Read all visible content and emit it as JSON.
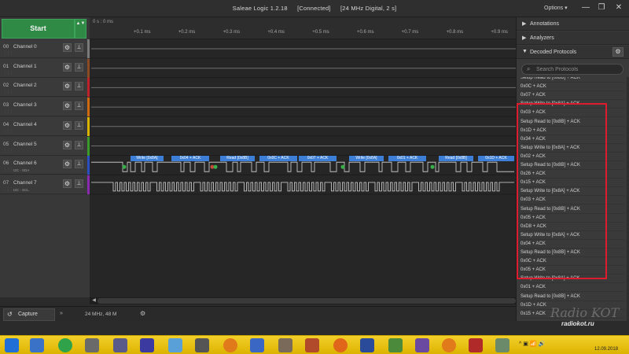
{
  "window": {
    "app": "Saleae Logic 1.2.18",
    "status": "[Connected]",
    "mode": "[24 MHz Digital, 2 s]",
    "options_label": "Options ▾",
    "minimize": "—",
    "restore": "❐",
    "close": "✕"
  },
  "controls": {
    "start_label": "Start",
    "start_arrows": "▲▼"
  },
  "channels": [
    {
      "num": "00",
      "name": "Channel 0",
      "sub": "",
      "color": "#7a7a7a"
    },
    {
      "num": "01",
      "name": "Channel 1",
      "sub": "",
      "color": "#8a4b22"
    },
    {
      "num": "02",
      "name": "Channel 2",
      "sub": "",
      "color": "#c0202a"
    },
    {
      "num": "03",
      "name": "Channel 3",
      "sub": "",
      "color": "#d06a10"
    },
    {
      "num": "04",
      "name": "Channel 4",
      "sub": "",
      "color": "#d8b400"
    },
    {
      "num": "05",
      "name": "Channel 5",
      "sub": "",
      "color": "#3a9a2a"
    },
    {
      "num": "06",
      "name": "Channel 6",
      "sub": "I2C - SDA",
      "color": "#2a4fc0"
    },
    {
      "num": "07",
      "name": "Channel 7",
      "sub": "I2C - SCL",
      "color": "#8a2ab0"
    }
  ],
  "timeline": {
    "origin": "0 s : 0 ms",
    "ticks": [
      "+0.1 ms",
      "+0.2 ms",
      "+0.3 ms",
      "+0.4 ms",
      "+0.5 ms",
      "+0.6 ms",
      "+0.7 ms",
      "+0.8 ms",
      "+0.9 ms"
    ]
  },
  "decoded_labels": [
    "Write [0x8A]",
    "0x04 + ACK",
    "Read [0x8B]",
    "0x0C + ACK",
    "0x07 + ACK",
    "Write [0x8A]",
    "0x01 + ACK",
    "Read [0x8B]",
    "0x1D + ACK"
  ],
  "bottom": {
    "capture_tab": "Capture",
    "rate_info": "24 MHz, 48 M"
  },
  "right_panel": {
    "annotations": "Annotations",
    "analyzers": "Analyzers",
    "decoded_protocols": "Decoded Protocols",
    "search_placeholder": "Search Protocols",
    "protocols": [
      "Setup Read to [0x8B] + ACK",
      "0x0C + ACK",
      "0x07 + ACK",
      "Setup Write to [0x8A] + ACK",
      "0x03 + ACK",
      "Setup Read to [0x8B] + ACK",
      "0x1D + ACK",
      "0x34 + ACK",
      "Setup Write to [0x8A] + ACK",
      "0x02 + ACK",
      "Setup Read to [0x8B] + ACK",
      "0x26 + ACK",
      "0x15 + ACK",
      "Setup Write to [0x8A] + ACK",
      "0x03 + ACK",
      "Setup Read to [0x8B] + ACK",
      "0x05 + ACK",
      "0xD8 + ACK",
      "Setup Write to [0x8A] + ACK",
      "0x04 + ACK",
      "Setup Read to [0x8B] + ACK",
      "0x0C + ACK",
      "0x05 + ACK",
      "Setup Write to [0x8A] + ACK",
      "0x01 + ACK",
      "Setup Read to [0x8B] + ACK",
      "0x1D + ACK",
      "0x15 + ACK"
    ]
  },
  "watermark": {
    "line1": "Radio KOT",
    "line2": "radiokot.ru"
  },
  "taskbar": {
    "tray": "^ ▣ 📶 🔊",
    "date": "12.09.2018"
  },
  "colors": {
    "accent_green": "#2f8a46",
    "highlight_red": "#e01b2b",
    "label_blue": "#3d7fd6"
  }
}
